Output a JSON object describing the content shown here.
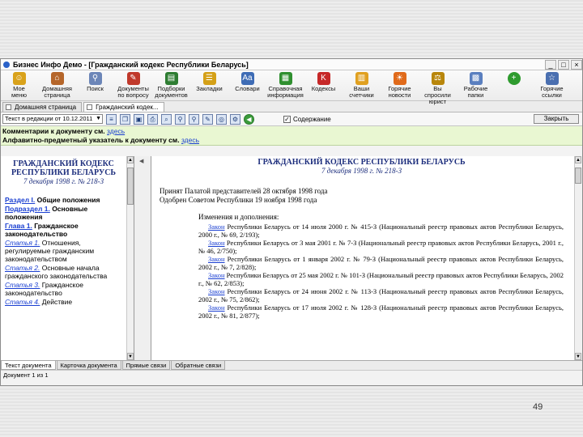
{
  "window": {
    "title": "Бизнес Инфо Демо - [Гражданский кодекс Республики Беларусь]",
    "buttons": [
      "_",
      "□",
      "×"
    ]
  },
  "toolbar": [
    {
      "label": "Мое\nменю",
      "icon": "home-icon",
      "color": "#d9a21b"
    },
    {
      "label": "Домашняя\nстраница",
      "icon": "house-icon",
      "color": "#b5662a"
    },
    {
      "label": "Поиск",
      "icon": "search-icon",
      "color": "#6c86b8"
    },
    {
      "label": "Документы\nпо вопросу",
      "icon": "documents-icon",
      "color": "#c0392b"
    },
    {
      "label": "Подборки\nдокументов",
      "icon": "books-icon",
      "color": "#2e7d32"
    },
    {
      "label": "Закладки",
      "icon": "bookmarks-icon",
      "color": "#d4a017"
    },
    {
      "label": "Словари",
      "icon": "dictionary-icon",
      "color": "#3e6cb5"
    },
    {
      "label": "Справочная\nинформация",
      "icon": "reference-icon",
      "color": "#2f8f2f"
    },
    {
      "label": "Кодексы",
      "icon": "codes-icon",
      "color": "#c62828"
    },
    {
      "label": "Ваши\nсчетчики",
      "icon": "counters-icon",
      "color": "#e0a020"
    },
    {
      "label": "Горячие\nновости",
      "icon": "news-icon",
      "color": "#e06a1a"
    },
    {
      "label": "Вы спросили\nюрист",
      "icon": "lawyer-icon",
      "color": "#b8860b"
    },
    {
      "label": "Рабочие\nпапки",
      "icon": "folders-icon",
      "color": "#5a7fbf"
    },
    {
      "label": "",
      "icon": "add-icon",
      "color": "#2e9b2e"
    },
    {
      "label": "Горячие\nссылки",
      "icon": "hot-links-icon",
      "color": "#4a6fb0"
    }
  ],
  "doc_tabs": [
    "Домашняя страница",
    "Гражданский кодек..."
  ],
  "secondary": {
    "edition": "Текст в редакции от 10.12.2011",
    "contents_label": "Содержание",
    "close_label": "Закрыть"
  },
  "info": {
    "comments_prefix": "Комментарии к документу см.",
    "comments_link": "здесь",
    "index_prefix": "Алфавитно-предметный указатель к документу см.",
    "index_link": "здесь"
  },
  "left": {
    "title": "ГРАЖДАНСКИЙ КОДЕКС РЕСПУБЛИКИ БЕЛАРУСЬ",
    "date": "7 декабря 1998 г. № 218-З",
    "toc": [
      {
        "link": "Раздел I.",
        "text": "Общие положения",
        "style": "bold"
      },
      {
        "link": "Подраздел 1.",
        "text": "Основные положения",
        "style": "bold"
      },
      {
        "link": "Глава 1.",
        "text": "Гражданское законодательство",
        "style": "bold"
      },
      {
        "link": "Статья 1.",
        "text": "Отношения, регулируемые гражданским законодательством",
        "style": "italic"
      },
      {
        "link": "Статья 2.",
        "text": "Основные начала гражданского законодательства",
        "style": "italic"
      },
      {
        "link": "Статья 3.",
        "text": "Гражданское законодательство",
        "style": "italic"
      },
      {
        "link": "Статья 4.",
        "text": "Действие",
        "style": "italic"
      }
    ]
  },
  "main": {
    "title": "ГРАЖДАНСКИЙ КОДЕКС РЕСПУБЛИКИ БЕЛАРУСЬ",
    "date": "7 декабря 1998 г. № 218-З",
    "adopted": "Принят Палатой представителей 28 октября 1998 года",
    "approved": "Одобрен Советом Республики 19 ноября 1998 года",
    "changes_header": "Изменения и дополнения:",
    "changes": [
      {
        "link": "Закон",
        "text": " Республики Беларусь от 14 июля 2000 г. № 415-З (Национальный реестр правовых актов Республики Беларусь, 2000 г., № 69, 2/193);"
      },
      {
        "link": "Закон",
        "text": " Республики Беларусь от 3 мая 2001 г. № 7-З (Национальный реестр правовых актов Республики Беларусь, 2001 г., № 46, 2/750);"
      },
      {
        "link": "Закон",
        "text": " Республики Беларусь от 1 января 2002 г. № 79-З (Национальный реестр правовых актов Республики Беларусь, 2002 г., № 7, 2/828);"
      },
      {
        "link": "Закон",
        "text": " Республики Беларусь от 25 мая 2002 г. № 101-З (Национальный реестр правовых актов Республики Беларусь, 2002 г., № 62, 2/853);"
      },
      {
        "link": "Закон",
        "text": " Республики Беларусь от 24 июня 2002 г. № 113-З (Национальный реестр правовых актов Республики Беларусь, 2002 г., № 75, 2/862);"
      },
      {
        "link": "Закон",
        "text": " Республики Беларусь от 17 июля 2002 г. № 128-З (Национальный реестр правовых актов Республики Беларусь, 2002 г., № 81, 2/877);"
      }
    ]
  },
  "status_tabs": [
    "Текст документа",
    "Карточка документа",
    "Прямые связи",
    "Обратные связи"
  ],
  "statusbar": "Документ 1 из 1",
  "slide_page_number": "49"
}
